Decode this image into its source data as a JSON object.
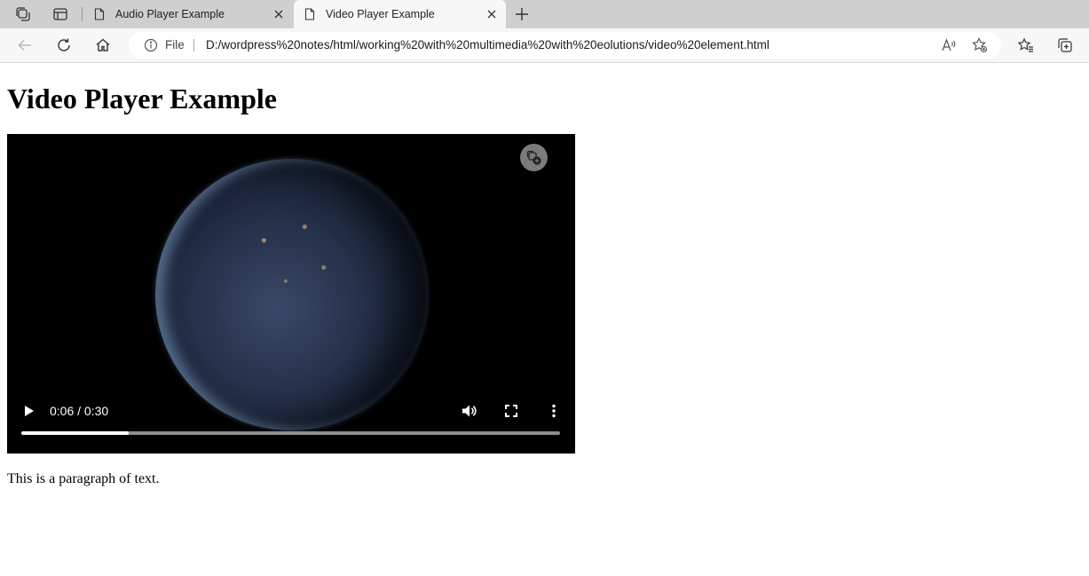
{
  "browser": {
    "tabs": [
      {
        "title": "Audio Player Example",
        "active": false
      },
      {
        "title": "Video Player Example",
        "active": true
      }
    ],
    "address": {
      "scheme_label": "File",
      "url": "D:/wordpress%20notes/html/working%20with%20multimedia%20with%20eolutions/video%20element.html"
    }
  },
  "page": {
    "heading": "Video Player Example",
    "paragraph": "This is a paragraph of text."
  },
  "video": {
    "time_display": "0:06 / 0:30",
    "progress_fraction": 0.2
  }
}
